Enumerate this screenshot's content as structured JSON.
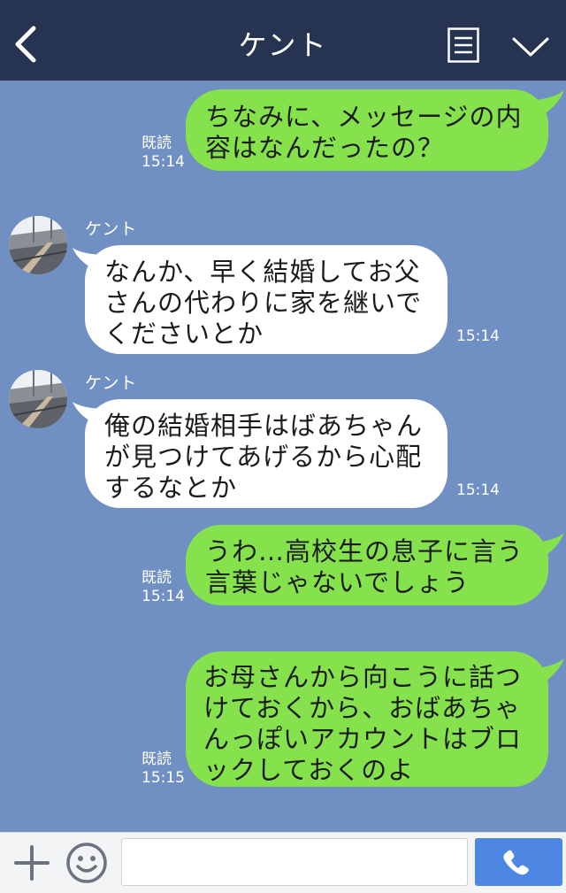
{
  "header": {
    "title": "ケント",
    "back_icon": "chevron-left-icon",
    "menu_icon": "document-menu-icon",
    "collapse_icon": "chevron-down-icon",
    "color": "#263451"
  },
  "chat": {
    "background_color": "#7090c4",
    "outgoing_color": "#85e24c",
    "incoming_color": "#ffffff",
    "messages": [
      {
        "direction": "outgoing",
        "text": "ちなみに、メッセージの内\n容はなんだったの？",
        "read_label": "既読",
        "time": "15:14"
      },
      {
        "direction": "incoming",
        "sender": "ケント",
        "text": "なんか、早く結婚してお父\nさんの代わりに家を継いで\nくださいとか",
        "time": "15:14"
      },
      {
        "direction": "incoming",
        "sender": "ケント",
        "text": "俺の結婚相手はばあちゃん\nが見つけてあげるから心配\nするなとか",
        "time": "15:14"
      },
      {
        "direction": "outgoing",
        "text": "うわ…高校生の息子に言う\n言葉じゃないでしょう",
        "read_label": "既読",
        "time": "15:14"
      },
      {
        "direction": "outgoing",
        "text": "お母さんから向こうに話つ\nけておくから、おばあちゃ\nんっぽいアカウントはブロ\nックしておくのよ",
        "read_label": "既読",
        "time": "15:15"
      }
    ]
  },
  "footer": {
    "plus_icon": "plus-icon",
    "emoji_icon": "smiley-icon",
    "input_value": "",
    "input_placeholder": "",
    "call_icon": "phone-icon",
    "call_color": "#4e86e4"
  }
}
